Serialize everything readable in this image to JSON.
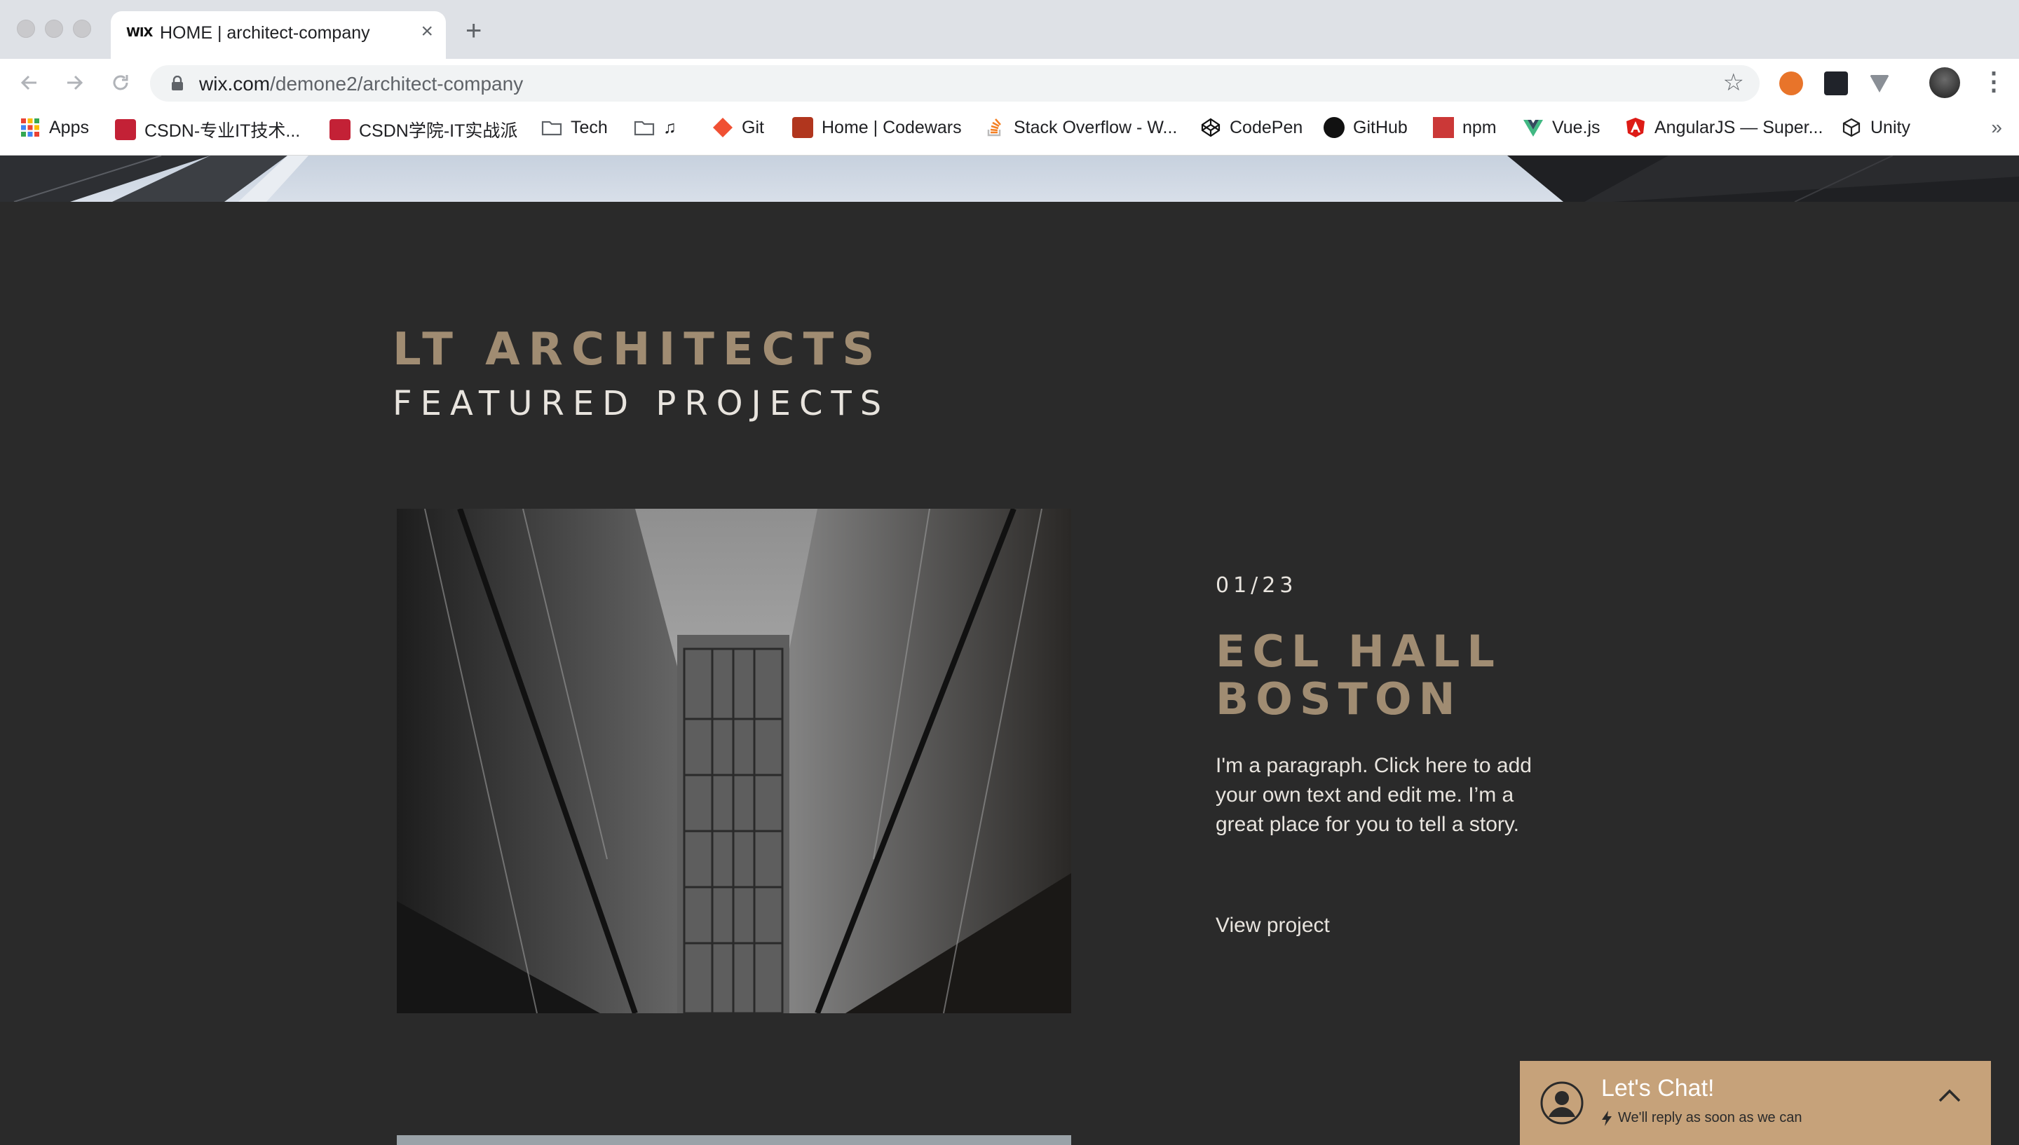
{
  "browser": {
    "tab": {
      "favicon_text": "WIX",
      "title": "HOME | architect-company"
    },
    "new_tab_symbol": "+",
    "close_symbol": "×",
    "address": {
      "host": "wix.com",
      "path": "/demone2/architect-company"
    },
    "bookmarks": [
      {
        "label": "Apps",
        "icon": "apps-grid-icon",
        "color": "#4285f4"
      },
      {
        "label": "CSDN-专业IT技术...",
        "icon": "csdn-icon",
        "color": "#c32136"
      },
      {
        "label": "CSDN学院-IT实战派",
        "icon": "csdn-icon",
        "color": "#c32136"
      },
      {
        "label": "Tech",
        "icon": "folder-icon",
        "color": "#5f6368"
      },
      {
        "label": "♫",
        "icon": "folder-icon",
        "color": "#5f6368"
      },
      {
        "label": "Git",
        "icon": "git-icon",
        "color": "#f05033"
      },
      {
        "label": "Home | Codewars",
        "icon": "codewars-icon",
        "color": "#b1361e"
      },
      {
        "label": "Stack Overflow - W...",
        "icon": "stackoverflow-icon",
        "color": "#f48024"
      },
      {
        "label": "CodePen",
        "icon": "codepen-icon",
        "color": "#111111"
      },
      {
        "label": "GitHub",
        "icon": "github-icon",
        "color": "#111111"
      },
      {
        "label": "npm",
        "icon": "npm-icon",
        "color": "#cb3837"
      },
      {
        "label": "Vue.js",
        "icon": "vue-icon",
        "color": "#41b883"
      },
      {
        "label": "AngularJS — Super...",
        "icon": "angular-icon",
        "color": "#dd1b16"
      },
      {
        "label": "Unity",
        "icon": "unity-icon",
        "color": "#222222"
      }
    ],
    "bookmarks_overflow": "»"
  },
  "page": {
    "brand": "LT ARCHITECTS",
    "subheading": "FEATURED PROJECTS",
    "project": {
      "counter": "01/23",
      "title_line1": "ECL HALL",
      "title_line2": "BOSTON",
      "description": "I'm a paragraph. Click here to add your own text and edit me. I’m a great place for you to tell a story.",
      "link": "View project"
    },
    "chat": {
      "title": "Let's Chat!",
      "subtitle": "We'll reply as soon as we can"
    }
  },
  "colors": {
    "background": "#2a2a2a",
    "accent": "#a08c72",
    "text_light": "#e8e4de",
    "chat_bg": "#c6a27a"
  }
}
